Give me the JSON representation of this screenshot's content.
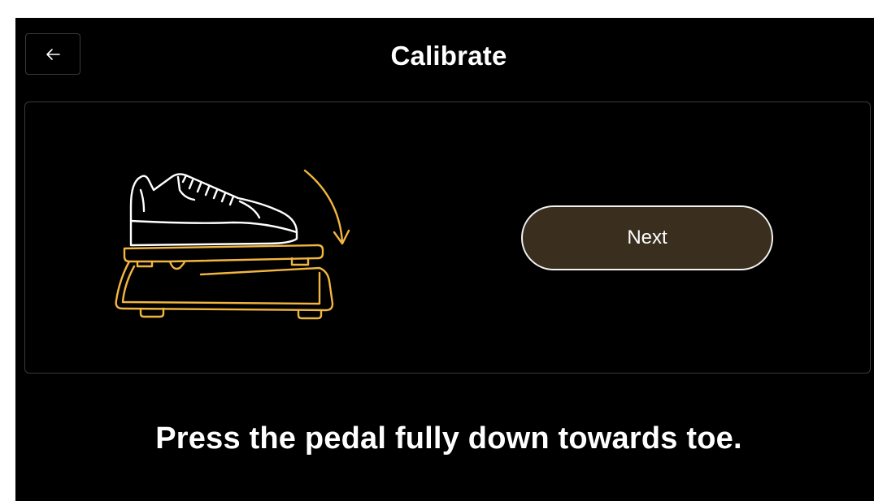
{
  "header": {
    "back_icon": "arrow-left-icon",
    "title": "Calibrate"
  },
  "panel": {
    "illustration": "shoe-on-expression-pedal",
    "next_label": "Next"
  },
  "instruction": "Press the pedal fully down towards toe.",
  "colors": {
    "background": "#000000",
    "accent": "#f2b640",
    "button_fill": "#3a2f1f",
    "text": "#ffffff",
    "border": "#3a3a3a"
  }
}
